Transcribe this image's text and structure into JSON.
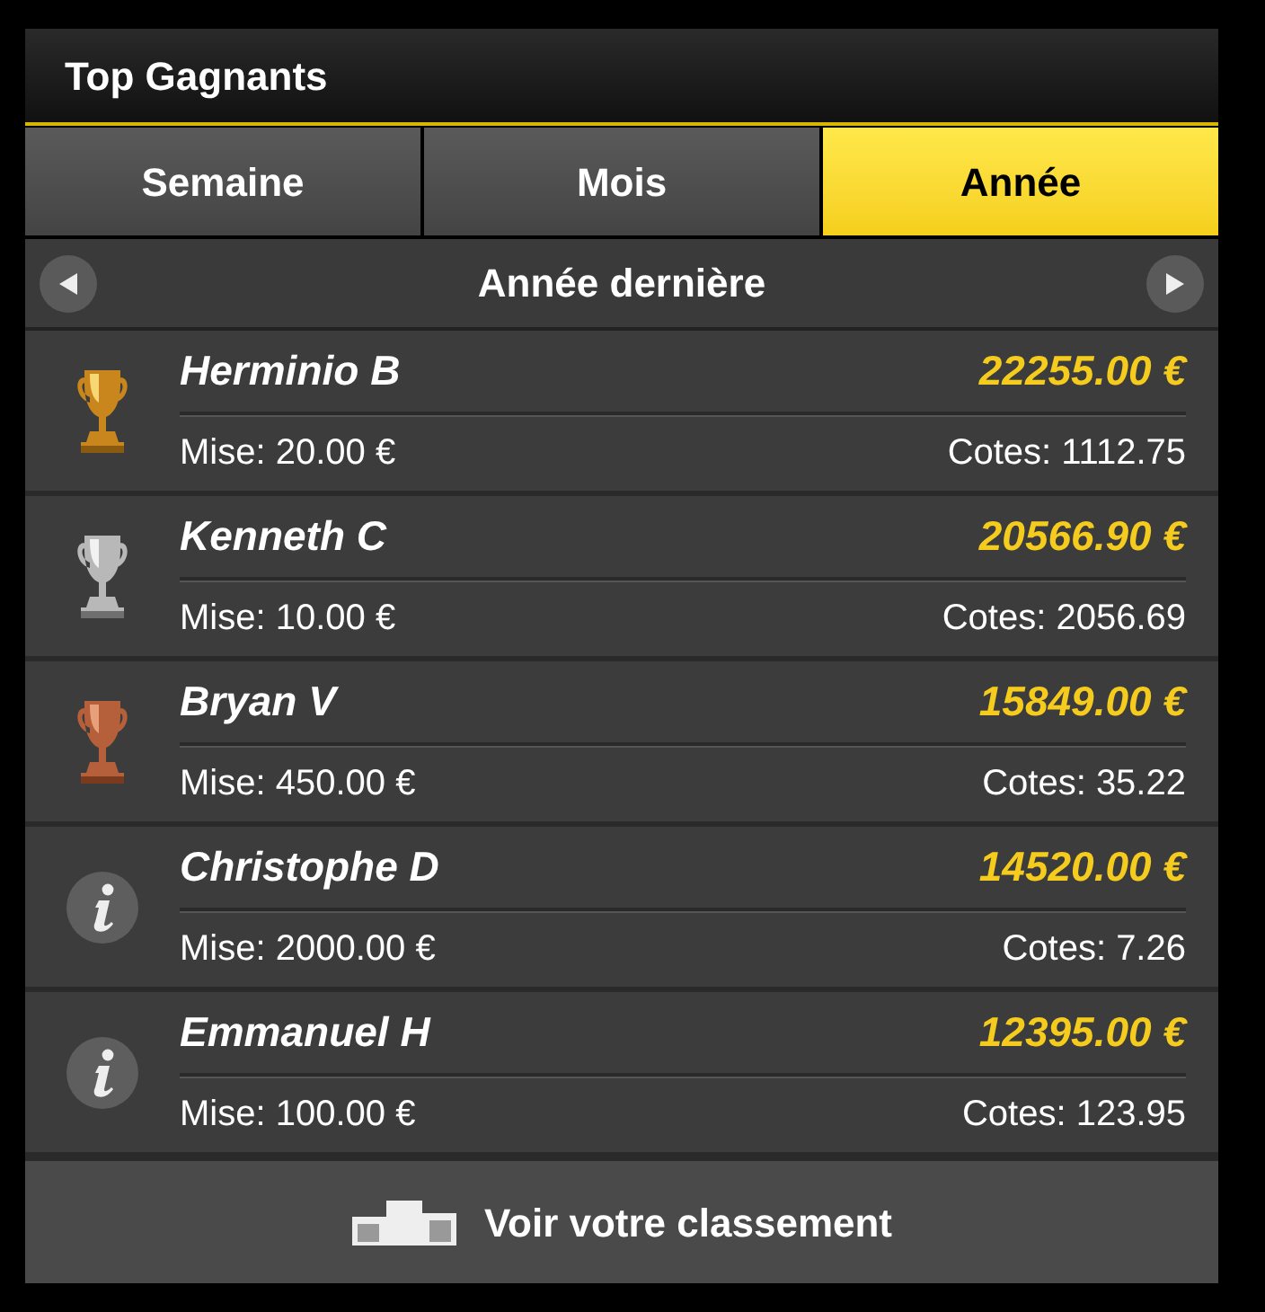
{
  "title": "Top Gagnants",
  "tabs": [
    {
      "label": "Semaine",
      "selected": false
    },
    {
      "label": "Mois",
      "selected": false
    },
    {
      "label": "Année",
      "selected": true
    }
  ],
  "period": {
    "label": "Année dernière"
  },
  "winners": [
    {
      "kind": "gold",
      "name": "Herminio B",
      "gain": "22255.00 €",
      "stake": "Mise: 20.00 €",
      "odds": "Cotes: 1112.75"
    },
    {
      "kind": "silver",
      "name": "Kenneth C",
      "gain": "20566.90 €",
      "stake": "Mise: 10.00 €",
      "odds": "Cotes: 2056.69"
    },
    {
      "kind": "bronze",
      "name": "Bryan V",
      "gain": "15849.00 €",
      "stake": "Mise: 450.00 €",
      "odds": "Cotes: 35.22"
    },
    {
      "kind": "info",
      "name": "Christophe D",
      "gain": "14520.00 €",
      "stake": "Mise: 2000.00 €",
      "odds": "Cotes: 7.26"
    },
    {
      "kind": "info",
      "name": "Emmanuel H",
      "gain": "12395.00 €",
      "stake": "Mise: 100.00 €",
      "odds": "Cotes: 123.95"
    }
  ],
  "footer": {
    "link": "Voir votre classement"
  }
}
